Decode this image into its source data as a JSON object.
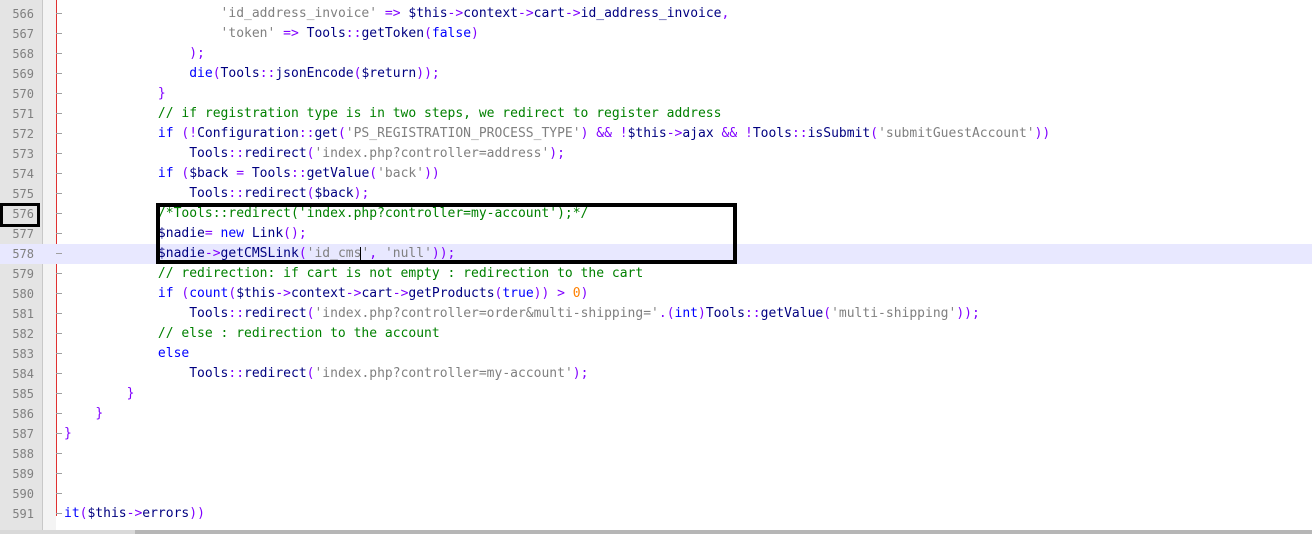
{
  "editor": {
    "first_line": 566,
    "current_line": 578,
    "lines": [
      {
        "num": "566",
        "indent": "                    ",
        "tokens": [
          [
            "str",
            "'id_address_invoice'"
          ],
          [
            "pl",
            " "
          ],
          [
            "op",
            "=>"
          ],
          [
            "pl",
            " "
          ],
          [
            "var",
            "$this"
          ],
          [
            "op",
            "->"
          ],
          [
            "pl",
            "context"
          ],
          [
            "op",
            "->"
          ],
          [
            "pl",
            "cart"
          ],
          [
            "op",
            "->"
          ],
          [
            "pl",
            "id_address_invoice"
          ],
          [
            "op",
            ","
          ]
        ]
      },
      {
        "num": "567",
        "indent": "                    ",
        "tokens": [
          [
            "str",
            "'token'"
          ],
          [
            "pl",
            " "
          ],
          [
            "op",
            "=>"
          ],
          [
            "pl",
            " Tools"
          ],
          [
            "op",
            "::"
          ],
          [
            "pl",
            "getToken"
          ],
          [
            "op",
            "("
          ],
          [
            "kw",
            "false"
          ],
          [
            "op",
            ")"
          ]
        ]
      },
      {
        "num": "568",
        "indent": "                ",
        "tokens": [
          [
            "op",
            ");"
          ]
        ]
      },
      {
        "num": "569",
        "indent": "                ",
        "tokens": [
          [
            "kw",
            "die"
          ],
          [
            "op",
            "("
          ],
          [
            "pl",
            "Tools"
          ],
          [
            "op",
            "::"
          ],
          [
            "pl",
            "jsonEncode"
          ],
          [
            "op",
            "("
          ],
          [
            "var",
            "$return"
          ],
          [
            "op",
            "));"
          ]
        ]
      },
      {
        "num": "570",
        "indent": "            ",
        "tokens": [
          [
            "op",
            "}"
          ]
        ]
      },
      {
        "num": "571",
        "indent": "            ",
        "tokens": [
          [
            "cmt",
            "// if registration type is in two steps, we redirect to register address"
          ]
        ]
      },
      {
        "num": "572",
        "indent": "            ",
        "tokens": [
          [
            "kw",
            "if"
          ],
          [
            "pl",
            " "
          ],
          [
            "op",
            "(!"
          ],
          [
            "pl",
            "Configuration"
          ],
          [
            "op",
            "::"
          ],
          [
            "pl",
            "get"
          ],
          [
            "op",
            "("
          ],
          [
            "str",
            "'PS_REGISTRATION_PROCESS_TYPE'"
          ],
          [
            "op",
            ")"
          ],
          [
            "pl",
            " "
          ],
          [
            "op",
            "&&"
          ],
          [
            "pl",
            " "
          ],
          [
            "op",
            "!"
          ],
          [
            "var",
            "$this"
          ],
          [
            "op",
            "->"
          ],
          [
            "pl",
            "ajax "
          ],
          [
            "op",
            "&&"
          ],
          [
            "pl",
            " "
          ],
          [
            "op",
            "!"
          ],
          [
            "pl",
            "Tools"
          ],
          [
            "op",
            "::"
          ],
          [
            "pl",
            "isSubmit"
          ],
          [
            "op",
            "("
          ],
          [
            "str",
            "'submitGuestAccount'"
          ],
          [
            "op",
            "))"
          ]
        ]
      },
      {
        "num": "573",
        "indent": "                ",
        "tokens": [
          [
            "pl",
            "Tools"
          ],
          [
            "op",
            "::"
          ],
          [
            "pl",
            "redirect"
          ],
          [
            "op",
            "("
          ],
          [
            "str",
            "'index.php?controller=address'"
          ],
          [
            "op",
            ");"
          ]
        ]
      },
      {
        "num": "574",
        "indent": "            ",
        "tokens": [
          [
            "kw",
            "if"
          ],
          [
            "pl",
            " "
          ],
          [
            "op",
            "("
          ],
          [
            "var",
            "$back"
          ],
          [
            "pl",
            " "
          ],
          [
            "op",
            "="
          ],
          [
            "pl",
            " Tools"
          ],
          [
            "op",
            "::"
          ],
          [
            "pl",
            "getValue"
          ],
          [
            "op",
            "("
          ],
          [
            "str",
            "'back'"
          ],
          [
            "op",
            "))"
          ]
        ]
      },
      {
        "num": "575",
        "indent": "                ",
        "tokens": [
          [
            "pl",
            "Tools"
          ],
          [
            "op",
            "::"
          ],
          [
            "pl",
            "redirect"
          ],
          [
            "op",
            "("
          ],
          [
            "var",
            "$back"
          ],
          [
            "op",
            ");"
          ]
        ]
      },
      {
        "num": "576",
        "indent": "            ",
        "tokens": [
          [
            "cmt",
            "/*Tools::redirect('index.php?controller=my-account');*/"
          ]
        ]
      },
      {
        "num": "577",
        "indent": "            ",
        "tokens": [
          [
            "var",
            "$nadie"
          ],
          [
            "op",
            "="
          ],
          [
            "pl",
            " "
          ],
          [
            "kw",
            "new"
          ],
          [
            "pl",
            " Link"
          ],
          [
            "op",
            "();"
          ]
        ]
      },
      {
        "num": "578",
        "indent": "            ",
        "tokens": [
          [
            "var",
            "$nadie"
          ],
          [
            "op",
            "->"
          ],
          [
            "pl",
            "getCMSLink"
          ],
          [
            "op",
            "("
          ],
          [
            "str",
            "'id_cms'"
          ],
          [
            "op",
            ","
          ],
          [
            "pl",
            " "
          ],
          [
            "str",
            "'null'"
          ],
          [
            "op",
            "));"
          ]
        ]
      },
      {
        "num": "579",
        "indent": "            ",
        "tokens": [
          [
            "cmt",
            "// redirection: if cart is not empty : redirection to the cart"
          ]
        ]
      },
      {
        "num": "580",
        "indent": "            ",
        "tokens": [
          [
            "kw",
            "if"
          ],
          [
            "pl",
            " "
          ],
          [
            "op",
            "("
          ],
          [
            "kw",
            "count"
          ],
          [
            "op",
            "("
          ],
          [
            "var",
            "$this"
          ],
          [
            "op",
            "->"
          ],
          [
            "pl",
            "context"
          ],
          [
            "op",
            "->"
          ],
          [
            "pl",
            "cart"
          ],
          [
            "op",
            "->"
          ],
          [
            "pl",
            "getProducts"
          ],
          [
            "op",
            "("
          ],
          [
            "kw",
            "true"
          ],
          [
            "op",
            "))"
          ],
          [
            "pl",
            " "
          ],
          [
            "op",
            ">"
          ],
          [
            "pl",
            " "
          ],
          [
            "num",
            "0"
          ],
          [
            "op",
            ")"
          ]
        ]
      },
      {
        "num": "581",
        "indent": "                ",
        "tokens": [
          [
            "pl",
            "Tools"
          ],
          [
            "op",
            "::"
          ],
          [
            "pl",
            "redirect"
          ],
          [
            "op",
            "("
          ],
          [
            "str",
            "'index.php?controller=order&multi-shipping='"
          ],
          [
            "op",
            "."
          ],
          [
            "op",
            "("
          ],
          [
            "kw",
            "int"
          ],
          [
            "op",
            ")"
          ],
          [
            "pl",
            "Tools"
          ],
          [
            "op",
            "::"
          ],
          [
            "pl",
            "getValue"
          ],
          [
            "op",
            "("
          ],
          [
            "str",
            "'multi-shipping'"
          ],
          [
            "op",
            "));"
          ]
        ]
      },
      {
        "num": "582",
        "indent": "            ",
        "tokens": [
          [
            "cmt",
            "// else : redirection to the account"
          ]
        ]
      },
      {
        "num": "583",
        "indent": "            ",
        "tokens": [
          [
            "kw",
            "else"
          ]
        ]
      },
      {
        "num": "584",
        "indent": "                ",
        "tokens": [
          [
            "pl",
            "Tools"
          ],
          [
            "op",
            "::"
          ],
          [
            "pl",
            "redirect"
          ],
          [
            "op",
            "("
          ],
          [
            "str",
            "'index.php?controller=my-account'"
          ],
          [
            "op",
            ");"
          ]
        ]
      },
      {
        "num": "585",
        "indent": "        ",
        "tokens": [
          [
            "op",
            "}"
          ]
        ]
      },
      {
        "num": "586",
        "indent": "    ",
        "tokens": [
          [
            "op",
            "}"
          ]
        ]
      },
      {
        "num": "587",
        "indent": "",
        "tokens": [
          [
            "op",
            "}"
          ]
        ]
      },
      {
        "num": "588",
        "indent": "",
        "tokens": []
      },
      {
        "num": "589",
        "indent": "",
        "tokens": []
      },
      {
        "num": "590",
        "indent": "",
        "tokens": []
      },
      {
        "num": "591",
        "indent": "",
        "tokens": [
          [
            "kw",
            "it"
          ],
          [
            "op",
            "("
          ],
          [
            "var",
            "$this"
          ],
          [
            "op",
            "->"
          ],
          [
            "pl",
            "errors"
          ],
          [
            "op",
            "))"
          ]
        ]
      }
    ]
  },
  "colors": {
    "string": "#808080",
    "comment": "#008000",
    "keyword": "#0000ff",
    "operator": "#8000ff",
    "plain": "#000080",
    "number": "#ff8000",
    "gutter_bg": "#e4e4e4",
    "current_line_bg": "#e8e8ff"
  }
}
